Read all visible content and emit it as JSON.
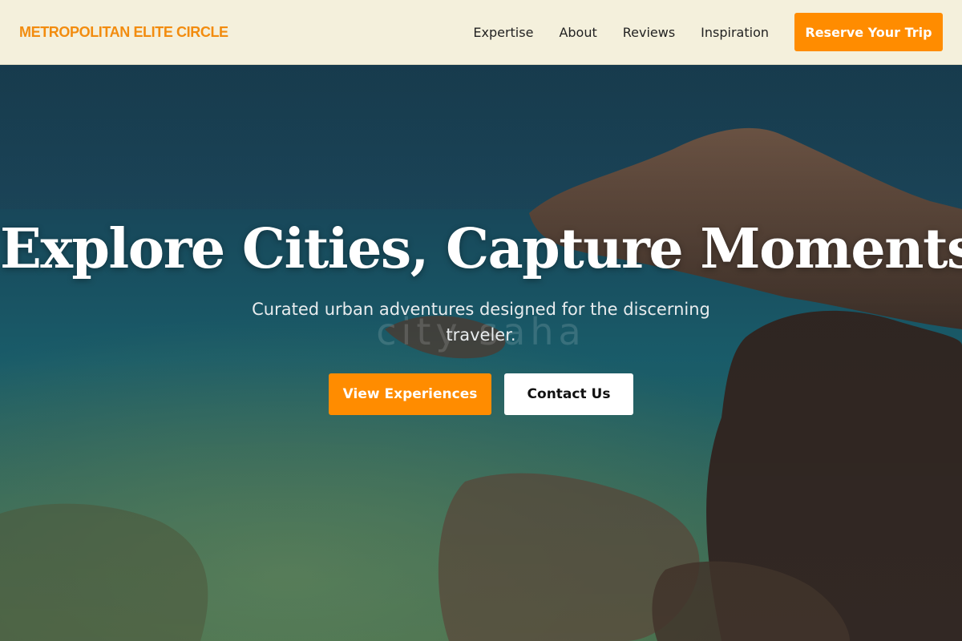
{
  "header": {
    "brand": "METROPOLITAN ELITE CIRCLE",
    "nav": [
      "Expertise",
      "About",
      "Reviews",
      "Inspiration"
    ],
    "cta_label": "Reserve Your Trip"
  },
  "hero": {
    "title": "Explore Cities, Capture Moments.",
    "subtitle": "Curated urban adventures designed for the discerning traveler.",
    "watermark": "city   saha",
    "primary_label": "View Experiences",
    "secondary_label": "Contact Us",
    "image_alt": "Rocky coastline with clear turquoise sea"
  },
  "colors": {
    "accent": "#ff8c00",
    "brand_text": "#f28c0f",
    "header_bg": "#f4f0dc"
  }
}
